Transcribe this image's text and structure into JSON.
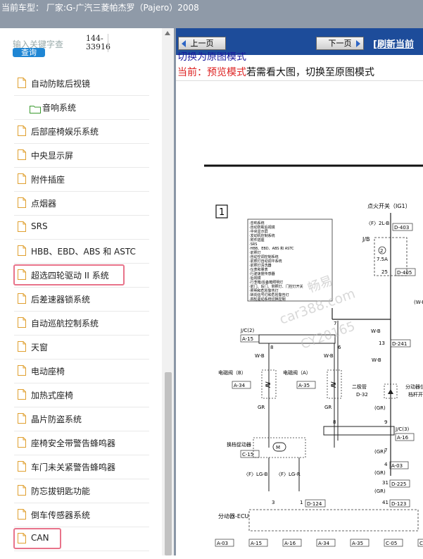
{
  "window": {
    "title": "当前车型：  厂家:G-广汽三菱帕杰罗（Pajero）2008"
  },
  "search": {
    "placeholder": "输入关键字查",
    "button": "查询",
    "code_line1": "144-",
    "code_line2": "33916"
  },
  "tree": {
    "items": [
      {
        "label": "自动防眩后视镜",
        "type": "file"
      },
      {
        "label": "音响系统",
        "type": "folder"
      },
      {
        "label": "后部座椅娱乐系统",
        "type": "file"
      },
      {
        "label": "中央显示屏",
        "type": "file"
      },
      {
        "label": "附件插座",
        "type": "file"
      },
      {
        "label": "点烟器",
        "type": "file"
      },
      {
        "label": "SRS",
        "type": "file"
      },
      {
        "label": "HBB、EBD、ABS 和 ASTC",
        "type": "file"
      },
      {
        "label": "超选四轮驱动 II 系统",
        "type": "file",
        "highlighted": true
      },
      {
        "label": "后差速器锁系统",
        "type": "file"
      },
      {
        "label": "自动巡航控制系统",
        "type": "file"
      },
      {
        "label": "天窗",
        "type": "file"
      },
      {
        "label": "电动座椅",
        "type": "file"
      },
      {
        "label": "加热式座椅",
        "type": "file"
      },
      {
        "label": "晶片防盗系统",
        "type": "file"
      },
      {
        "label": "座椅安全带警告蜂鸣器",
        "type": "file"
      },
      {
        "label": "车门未关紧警告蜂鸣器",
        "type": "file"
      },
      {
        "label": "防忘拔钥匙功能",
        "type": "file"
      },
      {
        "label": "倒车传感器系统",
        "type": "file"
      },
      {
        "label": "CAN",
        "type": "file",
        "highlighted": true
      }
    ]
  },
  "toolbar": {
    "prev": "上一页",
    "next": "下一页",
    "refresh": "[刷新当前"
  },
  "viewer": {
    "switch_link": "切换为原图模式",
    "mode_label": "当前：预览模式",
    "mode_hint": "若需看大图，切换至原图模式"
  },
  "diagram": {
    "box_number": "1",
    "ignition_label": "点火开关（IG1）",
    "fuse_list": [
      "·音响系统",
      "·自动防眩后视镜",
      "·中央显示屏",
      "·发动机控制系统",
      "·附件插座",
      "·SRS",
      "·HBB、EBD、ABS 和 ASTC",
      "·前照灯",
      "·自动空调控制系统",
      "·前照灯自动调平系统",
      "·前照灯清洗器",
      "·仪表和量表",
      "·行驶速度传感器",
      "·后视镜",
      "·行李箱/后备箱照明灯",
      "·前门、后门、侧照灯、门控灯开关",
      "·照明和危险警告灯",
      "·转向信号灯和危险警告灯",
      "·四轮驱动系统切换控制"
    ],
    "watermark1": "畅易",
    "watermark2": "car388.com",
    "watermark3": "CY20165",
    "wire_labels": {
      "f2lb": "〈F〉2L-B",
      "d403": "D-403",
      "jb": "J/B",
      "a75": "7.5A",
      "d405": "D-405",
      "wb": "W-B",
      "d241": "D-241",
      "jc2": "J/C(2)",
      "a15": "A-15",
      "jc3": "J/C(3)",
      "a16": "A-16",
      "gr": "GR",
      "d32": "D-32",
      "diode": "二极管",
      "solenoid_b": "电磁阀（B）",
      "solenoid_a": "电磁阀（A）",
      "a34": "A-34",
      "a35": "A-35",
      "shift_actuator": "换档促动器",
      "c15": "C-15",
      "f_lgb": "〈F〉LG-B",
      "f_lgr": "〈F〉LG-R",
      "d124": "D-124",
      "ecu": "分动器-ECU",
      "a03": "A-03",
      "d225": "D-225",
      "d123": "D-123",
      "dist_label": "分动器位",
      "shift_sw": "档杆开",
      "wb_right": "(W-B)"
    },
    "connectors": [
      "A-03",
      "A-15",
      "A-16",
      "A-34",
      "A-35",
      "C-05",
      "C-10"
    ]
  },
  "colors": {
    "toolbar": "#1d4c9a",
    "sidebar_highlight": "#e8738a",
    "query_button": "#1f86d4",
    "mode_label": "#dd2222",
    "topbar": "#8f9aa8"
  }
}
